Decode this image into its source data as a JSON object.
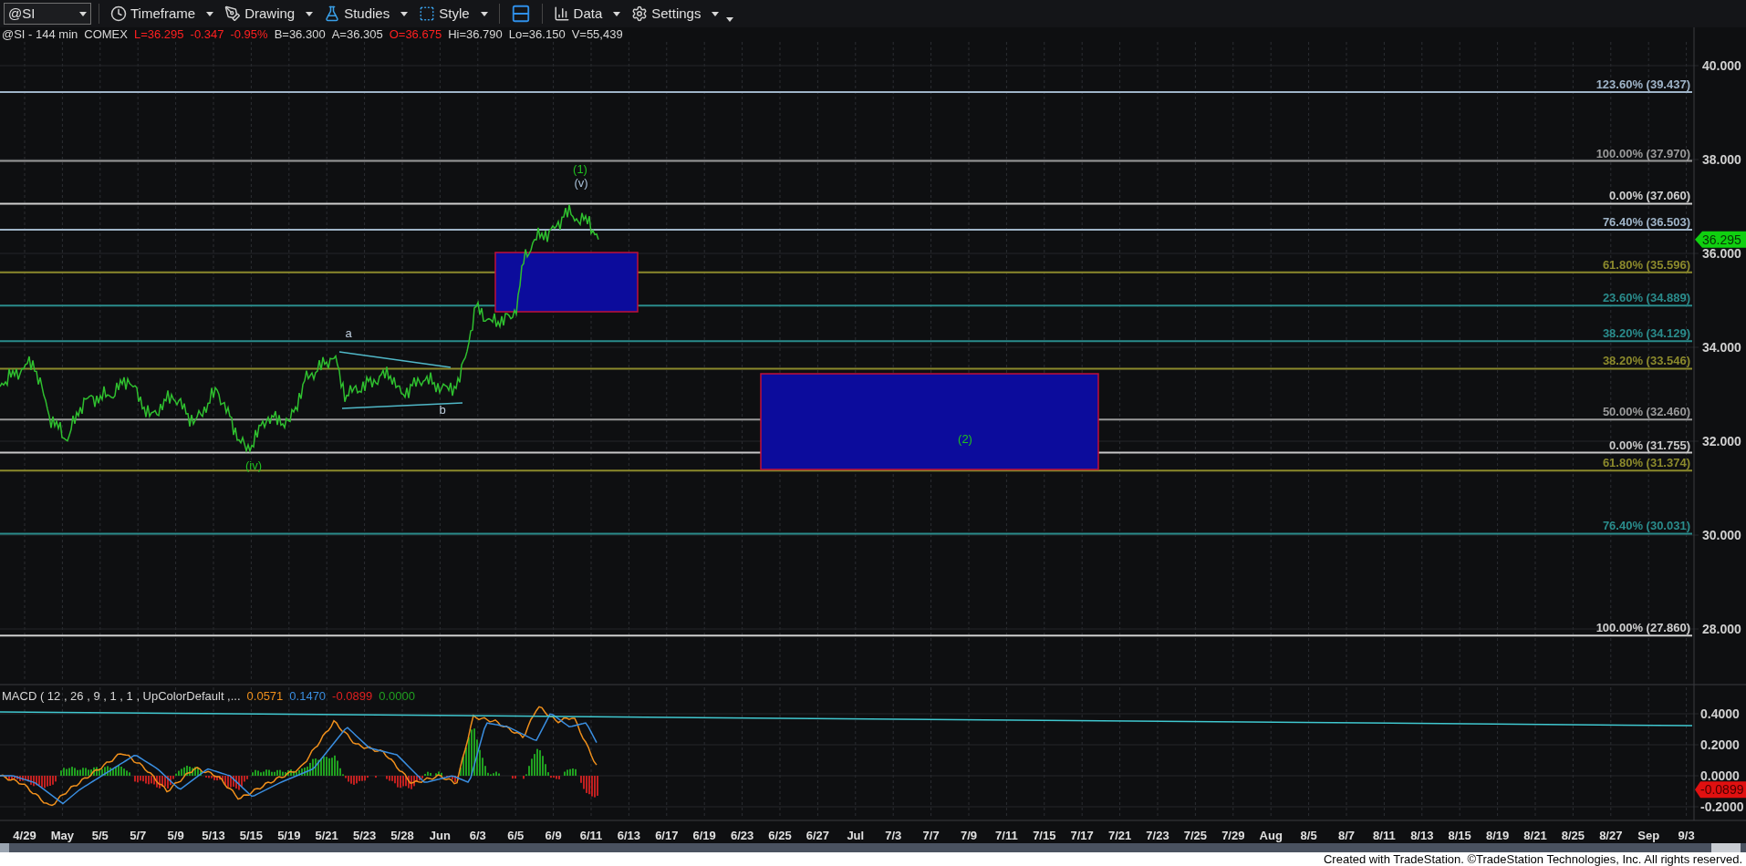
{
  "toolbar": {
    "symbol": {
      "value": "@SI"
    },
    "buttons": [
      {
        "label": "Timeframe"
      },
      {
        "label": "Drawing"
      },
      {
        "label": "Studies"
      },
      {
        "label": "Style"
      },
      {
        "label": "Data"
      },
      {
        "label": "Settings"
      }
    ]
  },
  "quote_line": [
    {
      "text": "@SI - 144 min",
      "color": "#d8d8d8"
    },
    {
      "text": "COMEX",
      "color": "#d8d8d8"
    },
    {
      "text": "L=36.295",
      "color": "#ff2020"
    },
    {
      "text": "-0.347",
      "color": "#ff2020"
    },
    {
      "text": "-0.95%",
      "color": "#ff2020"
    },
    {
      "text": "B=36.300",
      "color": "#d8d8d8"
    },
    {
      "text": "A=36.305",
      "color": "#d8d8d8"
    },
    {
      "text": "O=36.675",
      "color": "#ff2020"
    },
    {
      "text": "Hi=36.790",
      "color": "#d8d8d8"
    },
    {
      "text": "Lo=36.150",
      "color": "#d8d8d8"
    },
    {
      "text": "V=55,439",
      "color": "#d8d8d8"
    }
  ],
  "price_axis": [
    "40.000",
    "38.000",
    "36.000",
    "34.000",
    "32.000",
    "30.000",
    "28.000"
  ],
  "last_price": {
    "label": "36.295"
  },
  "fib_levels": [
    {
      "label": "123.60% (39.437)",
      "color": "#9fb4c8"
    },
    {
      "label": "100.00% (37.970)",
      "color": "#9a9a9a"
    },
    {
      "label": "0.00% (37.060)",
      "color": "#d0d0d0"
    },
    {
      "label": "76.40% (36.503)",
      "color": "#9fb4c8"
    },
    {
      "label": "61.80% (35.596)",
      "color": "#8c8a2c"
    },
    {
      "label": "23.60% (34.889)",
      "color": "#2a8c8c"
    },
    {
      "label": "38.20% (34.129)",
      "color": "#2a8c8c"
    },
    {
      "label": "38.20% (33.546)",
      "color": "#8c8a2c"
    },
    {
      "label": "50.00% (32.460)",
      "color": "#9a9a9a"
    },
    {
      "label": "0.00% (31.755)",
      "color": "#c8c8c8"
    },
    {
      "label": "61.80% (31.374)",
      "color": "#8c8a2c"
    },
    {
      "label": "76.40% (30.031)",
      "color": "#2a8c8c"
    },
    {
      "label": "100.00% (27.860)",
      "color": "#d0d0d0"
    }
  ],
  "wave_labels": [
    {
      "text": "a",
      "color": "#c0d0e0"
    },
    {
      "text": "b",
      "color": "#c0d0e0"
    },
    {
      "text": "(iv)",
      "color": "#20c020"
    },
    {
      "text": "(1)",
      "color": "#20c020"
    },
    {
      "text": "(v)",
      "color": "#a8c0d8"
    },
    {
      "text": "(2)",
      "color": "#20c020"
    }
  ],
  "macd": {
    "title": "MACD ( 12 , 26 , 9 , 1 , 1 , UpColorDefault ,...",
    "values": [
      {
        "text": "0.0571",
        "color": "#f0901c"
      },
      {
        "text": "0.1470",
        "color": "#3a8ee0"
      },
      {
        "text": "-0.0899",
        "color": "#e02020"
      },
      {
        "text": "0.0000",
        "color": "#20a020"
      }
    ],
    "axis": [
      "0.4000",
      "0.2000",
      "0.0000",
      "-0.2000"
    ],
    "last_value": {
      "label": "-0.0899"
    }
  },
  "date_axis": [
    "4/29",
    "May",
    "5/5",
    "5/7",
    "5/9",
    "5/13",
    "5/15",
    "5/19",
    "5/21",
    "5/23",
    "5/28",
    "Jun",
    "6/3",
    "6/5",
    "6/9",
    "6/11",
    "6/13",
    "6/17",
    "6/19",
    "6/23",
    "6/25",
    "6/27",
    "Jul",
    "7/3",
    "7/7",
    "7/9",
    "7/11",
    "7/15",
    "7/17",
    "7/21",
    "7/23",
    "7/25",
    "7/29",
    "Aug",
    "8/5",
    "8/7",
    "8/11",
    "8/13",
    "8/15",
    "8/19",
    "8/21",
    "8/25",
    "8/27",
    "Sep",
    "9/3"
  ],
  "footer": "Created with TradeStation. ©TradeStation Technologies, Inc. All rights reserved."
}
